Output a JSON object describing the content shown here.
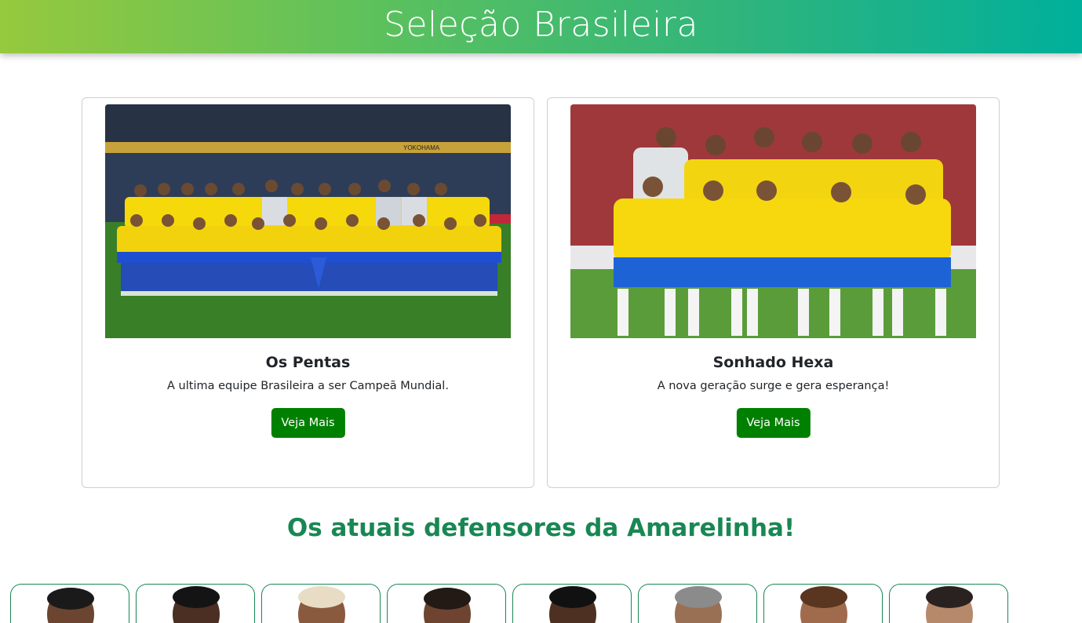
{
  "header": {
    "title": "Seleção Brasileira"
  },
  "cards": [
    {
      "title": "Os Pentas",
      "description": "A ultima equipe Brasileira a ser Campeã Mundial.",
      "button_label": "Veja Mais",
      "image_banner": "YOKOHAMA"
    },
    {
      "title": "Sonhado Hexa",
      "description": "A nova geração surge e gera esperança!",
      "button_label": "Veja Mais"
    }
  ],
  "players_section": {
    "title": "Os atuais defensores da Amarelinha!",
    "player_count": 8
  },
  "colors": {
    "header_gradient_start": "#96c93d",
    "header_gradient_end": "#00b09b",
    "button": "#008000",
    "section_title": "#198754",
    "jersey_yellow": "#f5d90a",
    "shorts_blue": "#1f4fd1",
    "pitch_green": "#3f8a2c"
  }
}
